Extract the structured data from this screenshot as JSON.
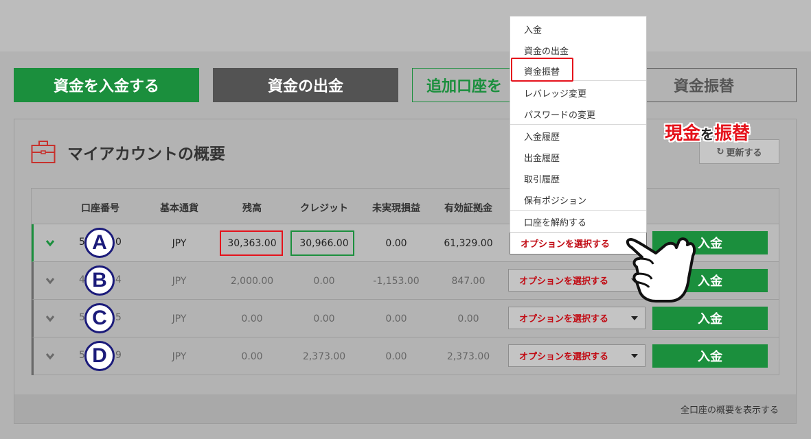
{
  "actions": {
    "deposit": "資金を入金する",
    "withdraw": "資金の出金",
    "add_account": "追加口座を",
    "transfer": "資金振替"
  },
  "overview": {
    "title": "マイアカウントの概要",
    "refresh": "更新する",
    "show_all": "全口座の概要を表示する"
  },
  "table": {
    "headers": [
      "口座番号",
      "基本通貨",
      "残高",
      "クレジット",
      "未実現損益",
      "有効証拠金"
    ],
    "rows": [
      {
        "marker": "A",
        "acct_start": "5",
        "acct_end": "0",
        "currency": "JPY",
        "balance": "30,363.00",
        "credit": "30,966.00",
        "unrealized": "0.00",
        "equity": "61,329.00",
        "option": "オプションを選択する",
        "deposit": "入金"
      },
      {
        "marker": "B",
        "acct_start": "4",
        "acct_end": "4",
        "currency": "JPY",
        "balance": "2,000.00",
        "credit": "0.00",
        "unrealized": "-1,153.00",
        "equity": "847.00",
        "option": "オプションを選択する",
        "deposit": "入金"
      },
      {
        "marker": "C",
        "acct_start": "5",
        "acct_end": "5",
        "currency": "JPY",
        "balance": "0.00",
        "credit": "0.00",
        "unrealized": "0.00",
        "equity": "0.00",
        "option": "オプションを選択する",
        "deposit": "入金"
      },
      {
        "marker": "D",
        "acct_start": "5",
        "acct_end": "9",
        "currency": "JPY",
        "balance": "0.00",
        "credit": "2,373.00",
        "unrealized": "0.00",
        "equity": "2,373.00",
        "option": "オプションを選択する",
        "deposit": "入金"
      }
    ]
  },
  "menu": {
    "items": [
      "入金",
      "資金の出金",
      "資金振替",
      "レバレッジ変更",
      "パスワードの変更",
      "入金履歴",
      "出金履歴",
      "取引履歴",
      "保有ポジション",
      "口座を解約する"
    ]
  },
  "annotation": {
    "part1": "現金",
    "connector": "を",
    "part2": "振替"
  },
  "icons": {
    "briefcase": "briefcase-icon",
    "refresh": "refresh-icon",
    "chevron": "chevron-down-icon",
    "caret": "caret-down-icon",
    "hand": "pointing-hand-icon"
  },
  "colors": {
    "brand_green": "#1b8f3d",
    "alert_red": "#e5121b",
    "option_red": "#c10a13",
    "marker_navy": "#1b1b7a"
  }
}
